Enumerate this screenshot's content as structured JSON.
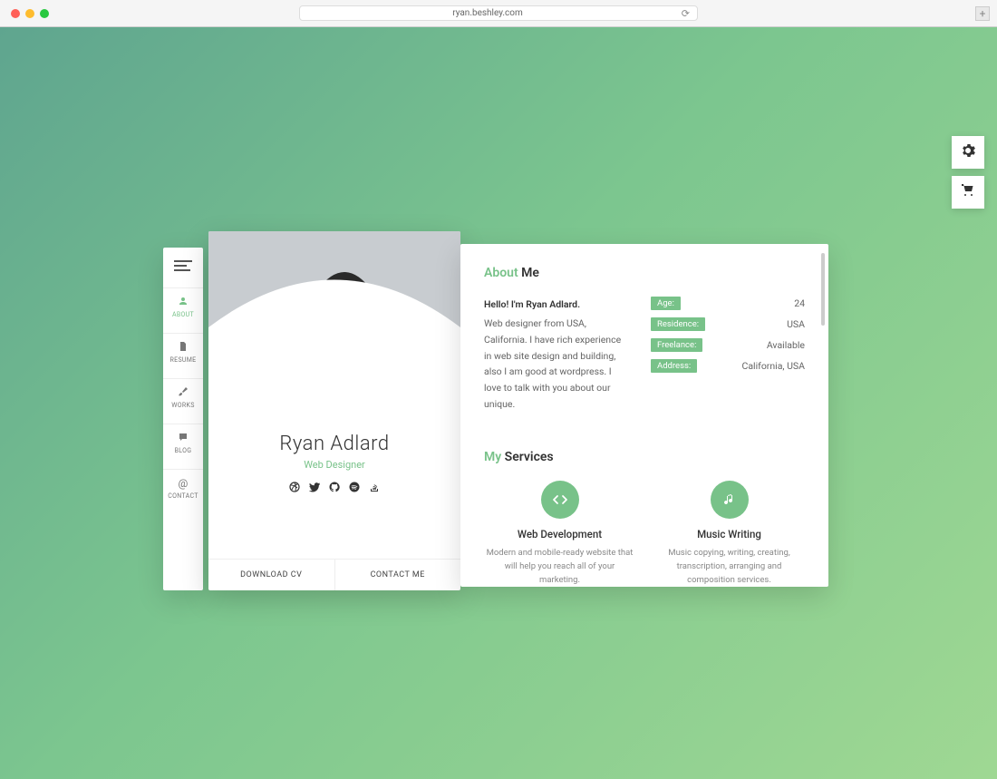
{
  "browser": {
    "url": "ryan.beshley.com"
  },
  "nav": {
    "items": [
      {
        "label": "ABOUT"
      },
      {
        "label": "RESUME"
      },
      {
        "label": "WORKS"
      },
      {
        "label": "BLOG"
      },
      {
        "label": "CONTACT"
      }
    ]
  },
  "profile": {
    "name": "Ryan Adlard",
    "role": "Web Designer",
    "download_label": "DOWNLOAD CV",
    "contact_label": "CONTACT ME"
  },
  "about": {
    "title_accent": "About",
    "title_rest": " Me",
    "greeting": "Hello! I'm Ryan Adlard.",
    "bio": "Web designer from USA, California. I have rich experience in web site design and building, also I am good at wordpress. I love to talk with you about our unique.",
    "info": [
      {
        "label": "Age:",
        "value": "24"
      },
      {
        "label": "Residence:",
        "value": "USA"
      },
      {
        "label": "Freelance:",
        "value": "Available"
      },
      {
        "label": "Address:",
        "value": "California, USA"
      }
    ]
  },
  "services": {
    "title_accent": "My",
    "title_rest": " Services",
    "items": [
      {
        "title": "Web Development",
        "desc": "Modern and mobile-ready website that will help you reach all of your marketing."
      },
      {
        "title": "Music Writing",
        "desc": "Music copying, writing, creating, transcription, arranging and composition services."
      }
    ]
  }
}
